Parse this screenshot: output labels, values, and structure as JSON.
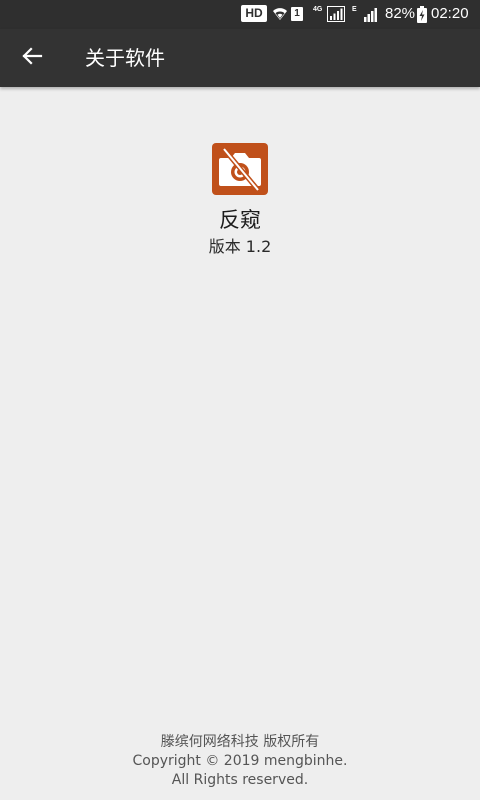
{
  "status_bar": {
    "hd_badge": "HD",
    "sim_slot": "1",
    "network_type_1": "4G",
    "network_type_2": "E",
    "battery_percent": "82%",
    "time": "02:20",
    "icons": [
      "wifi-icon",
      "signal-icon",
      "battery-charging-icon"
    ]
  },
  "app_bar": {
    "title": "关于软件",
    "back_icon": "arrow-left-icon"
  },
  "about": {
    "app_name": "反窥",
    "version": "版本 1.2",
    "logo_icon": "camera-off-icon",
    "logo_color": "#c0501a"
  },
  "footer": {
    "copyright_holder": "滕缤何网络科技 版权所有",
    "copyright_line": "Copyright © 2019 mengbinhe.",
    "rights": "All Rights reserved."
  },
  "colors": {
    "app_bar": "#333333",
    "status_bar": "#2f2f2f",
    "background": "#eeeeee"
  }
}
